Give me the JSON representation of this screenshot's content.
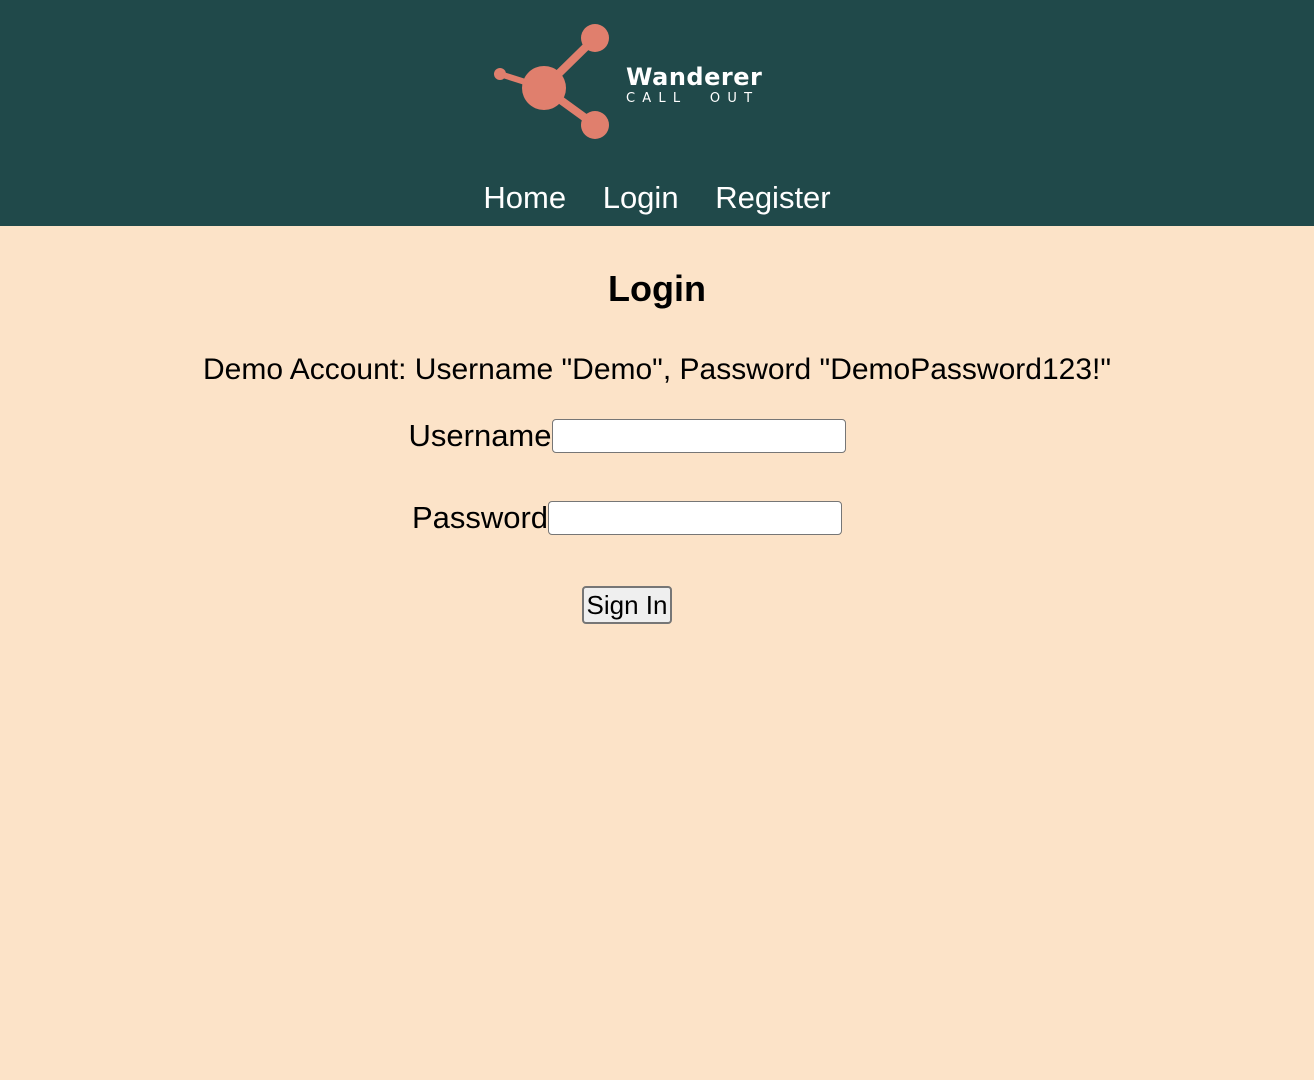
{
  "header": {
    "brand_name": "Wanderer",
    "brand_sub": "CALL  OUT",
    "logo_icon": "network-node-icon",
    "logo_color": "#e07f6d",
    "background_color": "#20494a"
  },
  "nav": {
    "items": [
      {
        "label": "Home"
      },
      {
        "label": "Login"
      },
      {
        "label": "Register"
      }
    ]
  },
  "page": {
    "title": "Login",
    "demo_text": "Demo Account: Username \"Demo\", Password \"DemoPassword123!\"",
    "background_color": "#fce3c8"
  },
  "form": {
    "username_label": "Username",
    "username_value": "",
    "password_label": "Password",
    "password_value": "",
    "submit_label": "Sign In"
  }
}
